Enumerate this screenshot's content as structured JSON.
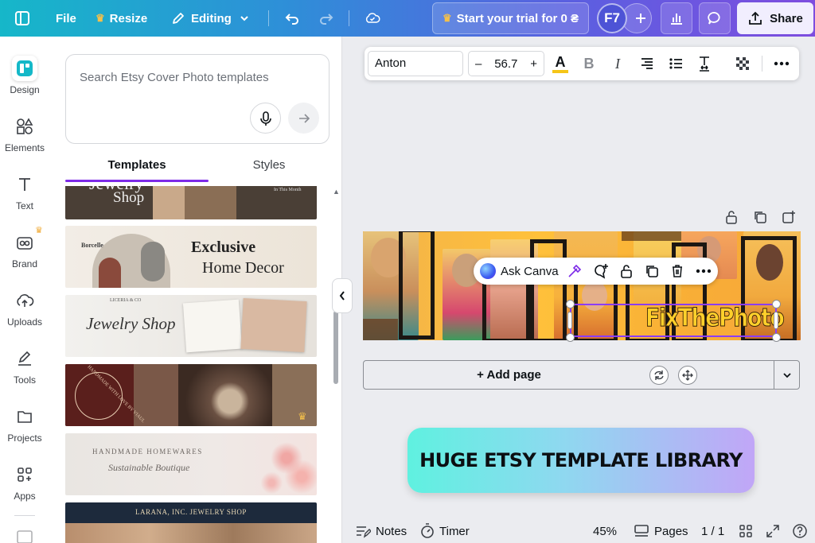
{
  "topbar": {
    "file_label": "File",
    "resize_label": "Resize",
    "editing_label": "Editing",
    "trial_label": "Start your trial for 0 ₴",
    "avatar_initials": "F7",
    "share_label": "Share"
  },
  "rail": {
    "items": [
      {
        "label": "Design"
      },
      {
        "label": "Elements"
      },
      {
        "label": "Text"
      },
      {
        "label": "Brand"
      },
      {
        "label": "Uploads"
      },
      {
        "label": "Tools"
      },
      {
        "label": "Projects"
      },
      {
        "label": "Apps"
      }
    ]
  },
  "panel": {
    "search_placeholder": "Search Etsy Cover Photo templates",
    "tabs": [
      "Templates",
      "Styles"
    ],
    "templates": [
      {
        "line1": "Jewelry",
        "line2": "Shop",
        "small": "In This Month"
      },
      {
        "brand": "Borcelle",
        "line1": "Exclusive",
        "line2": "Home Decor"
      },
      {
        "brand": "LICERIA & CO",
        "line1": "Jewelry Shop"
      },
      {
        "line1": "HANDMADE WITH LOVE BY VIAUL"
      },
      {
        "line1": "HANDMADE HOMEWARES",
        "line2": "Sustainable Boutique"
      },
      {
        "line1": "LARANA, INC. JEWELRY SHOP"
      }
    ]
  },
  "text_toolbar": {
    "font": "Anton",
    "size": "56.7",
    "underline_color": "#f5c518"
  },
  "canvas": {
    "design_text": "FixThePhoto",
    "context_menu_label": "Ask Canva",
    "add_page_label": "+ Add page",
    "promo_text": "HUGE ETSY TEMPLATE LIBRARY"
  },
  "bottombar": {
    "notes_label": "Notes",
    "timer_label": "Timer",
    "zoom": "45%",
    "pages_label": "Pages",
    "page_count": "1 / 1"
  },
  "colors": {
    "accent": "#7d2ae8",
    "selection": "#8b3dff",
    "crown": "#f0a830"
  }
}
